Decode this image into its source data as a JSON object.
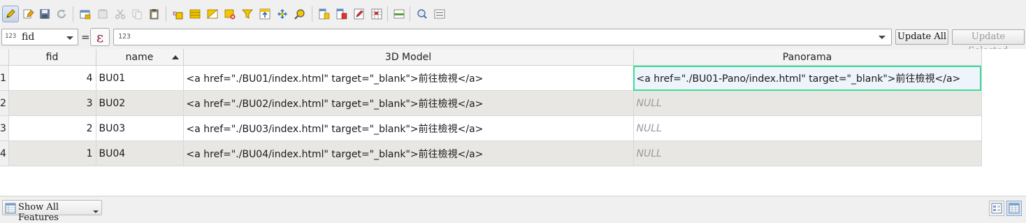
{
  "toolbar": {
    "buttons": [
      {
        "name": "toggle-editing-icon",
        "color": "#e2b500"
      },
      {
        "name": "toggle-multi-edit-icon",
        "color": "#d98c00"
      },
      {
        "name": "save-edits-icon",
        "color": "#5a6f8f"
      },
      {
        "name": "reload-table-icon",
        "color": "#9aa4ad"
      },
      {
        "name": "add-feature-icon",
        "color": "#4a90d9"
      },
      {
        "name": "delete-selected-icon",
        "color": "#b0b0b0"
      },
      {
        "name": "cut-icon",
        "color": "#b0b0b0"
      },
      {
        "name": "copy-icon",
        "color": "#b0b0b0"
      },
      {
        "name": "paste-icon",
        "color": "#8c7a5a"
      },
      {
        "name": "select-by-expression-icon",
        "color": "#e2b500"
      },
      {
        "name": "select-all-icon",
        "color": "#e2b500"
      },
      {
        "name": "invert-selection-icon",
        "color": "#e2b500"
      },
      {
        "name": "deselect-all-icon",
        "color": "#e2b500"
      },
      {
        "name": "filter-icon",
        "color": "#e2b500"
      },
      {
        "name": "move-selection-to-top-icon",
        "color": "#3a7ab8"
      },
      {
        "name": "pan-to-selected-icon",
        "color": "#3a7ab8"
      },
      {
        "name": "zoom-to-selected-icon",
        "color": "#e2b500"
      },
      {
        "name": "new-field-icon",
        "color": "#e2b500"
      },
      {
        "name": "delete-field-icon",
        "color": "#cc3333"
      },
      {
        "name": "field-calculator-icon",
        "color": "#cc3333"
      },
      {
        "name": "conditional-formatting-icon",
        "color": "#5a8f3a"
      },
      {
        "name": "dock-table-icon",
        "color": "#5a8f3a"
      },
      {
        "name": "actions-icon",
        "color": "#4a6fa5"
      },
      {
        "name": "form-view-icon",
        "color": "#7a7a7a"
      }
    ]
  },
  "expression_bar": {
    "field_type": "123",
    "field": "fid",
    "equals": "=",
    "expression_icon": "ε",
    "expression_value": "123",
    "update_all_label": "Update All",
    "update_selected_label": "Update Selected"
  },
  "table": {
    "headers": [
      "fid",
      "name",
      "3D Model",
      "Panorama"
    ],
    "sorted_column": "name",
    "rows": [
      {
        "row_number": "1",
        "fid": "4",
        "name": "BU01",
        "model": "<a href=\"./BU01/index.html\"  target=\"_blank\">前往檢視</a>",
        "panorama": "<a href=\"./BU01-Pano/index.html\" target=\"_blank\">前往檢視</a>"
      },
      {
        "row_number": "2",
        "fid": "3",
        "name": "BU02",
        "model": "<a href=\"./BU02/index.html\" target=\"_blank\">前往檢視</a>",
        "panorama": "NULL"
      },
      {
        "row_number": "3",
        "fid": "2",
        "name": "BU03",
        "model": "<a href=\"./BU03/index.html\" target=\"_blank\">前往檢視</a>",
        "panorama": "NULL"
      },
      {
        "row_number": "4",
        "fid": "1",
        "name": "BU04",
        "model": "<a href=\"./BU04/index.html\" target=\"_blank\">前往檢視</a>",
        "panorama": "NULL"
      }
    ]
  },
  "statusbar": {
    "show_features_label": "Show All Features",
    "views": [
      "form-view-icon",
      "table-view-icon"
    ]
  }
}
